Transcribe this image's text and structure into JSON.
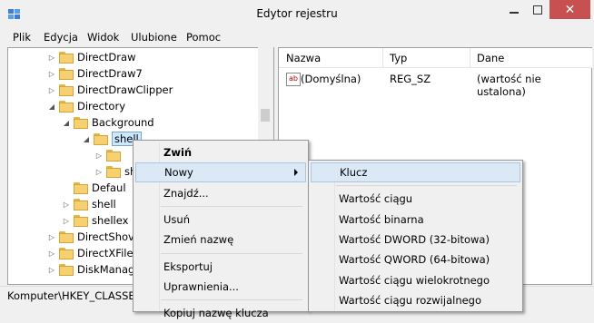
{
  "window": {
    "title": "Edytor rejestru",
    "close_glyph": "✕"
  },
  "menubar": [
    {
      "label": "Plik"
    },
    {
      "label": "Edycja"
    },
    {
      "label": "Widok"
    },
    {
      "label": "Ulubione"
    },
    {
      "label": "Pomoc"
    }
  ],
  "tree": [
    {
      "label": "DirectDraw",
      "arrow": "▷",
      "selected": false
    },
    {
      "label": "DirectDraw7",
      "arrow": "▷",
      "selected": false
    },
    {
      "label": "DirectDrawClipper",
      "arrow": "▷",
      "selected": false
    },
    {
      "label": "Directory",
      "arrow": "◢",
      "selected": false
    },
    {
      "label": "Background",
      "arrow": "◢",
      "selected": false
    },
    {
      "label": "shell",
      "arrow": "◢",
      "selected": true
    },
    {
      "label": "",
      "arrow": "▷",
      "selected": false
    },
    {
      "label": "she",
      "arrow": "▷",
      "selected": false
    },
    {
      "label": "Defaul",
      "arrow": "",
      "selected": false
    },
    {
      "label": "shell",
      "arrow": "▷",
      "selected": false
    },
    {
      "label": "shellex",
      "arrow": "▷",
      "selected": false
    },
    {
      "label": "DirectShov",
      "arrow": "▷",
      "selected": false
    },
    {
      "label": "DirectXFile",
      "arrow": "▷",
      "selected": false
    },
    {
      "label": "DiskManag",
      "arrow": "▷",
      "selected": false
    }
  ],
  "list": {
    "headers": [
      "Nazwa",
      "Typ",
      "Dane"
    ],
    "rows": [
      {
        "icon": "ab",
        "name": "(Domyślna)",
        "type": "REG_SZ",
        "data": "(wartość nie ustalona)"
      }
    ]
  },
  "statusbar": {
    "path": "Komputer\\HKEY_CLASSES"
  },
  "context_menu": [
    {
      "label": "Zwiń",
      "bold": true
    },
    {
      "label": "Nowy",
      "submenu": true,
      "highlighted": true
    },
    {
      "label": "Znajdź..."
    },
    {
      "sep": true
    },
    {
      "label": "Usuń"
    },
    {
      "label": "Zmień nazwę"
    },
    {
      "sep": true
    },
    {
      "label": "Eksportuj"
    },
    {
      "label": "Uprawnienia..."
    },
    {
      "sep": true
    },
    {
      "label": "Kopiuj nazwę klucza"
    }
  ],
  "submenu": [
    {
      "label": "Klucz",
      "highlighted": true
    },
    {
      "sep": true
    },
    {
      "label": "Wartość ciągu"
    },
    {
      "label": "Wartość binarna"
    },
    {
      "label": "Wartość DWORD (32-bitowa)"
    },
    {
      "label": "Wartość QWORD (64-bitowa)"
    },
    {
      "label": "Wartość ciągu wielokrotnego"
    },
    {
      "label": "Wartość ciągu rozwijalnego"
    }
  ]
}
